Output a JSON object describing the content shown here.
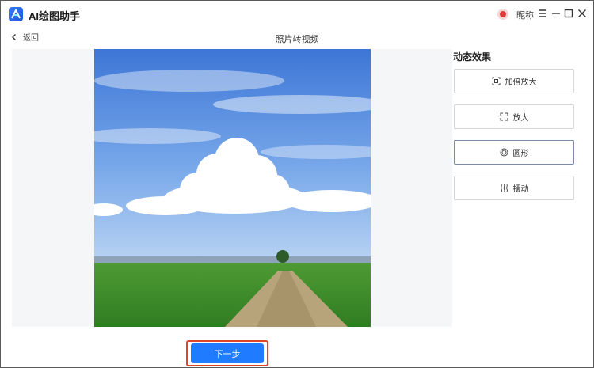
{
  "app": {
    "title": "AI绘图助手",
    "logo_letter": "A"
  },
  "user": {
    "nickname": "昵称"
  },
  "header": {
    "back_label": "返回",
    "page_title": "照片转视频"
  },
  "effects": {
    "title": "动态效果",
    "items": [
      {
        "label": "加倍放大",
        "icon": "zoom-frame-icon",
        "selected": false
      },
      {
        "label": "放大",
        "icon": "expand-corners-icon",
        "selected": false
      },
      {
        "label": "圆形",
        "icon": "circle-icon",
        "selected": true
      },
      {
        "label": "摆动",
        "icon": "wave-icon",
        "selected": false
      }
    ]
  },
  "actions": {
    "next_label": "下一步"
  },
  "colors": {
    "accent": "#1f7bff",
    "highlight_border": "#e0442d",
    "sky": "#5f8fe0",
    "grass": "#3f9a2e"
  }
}
